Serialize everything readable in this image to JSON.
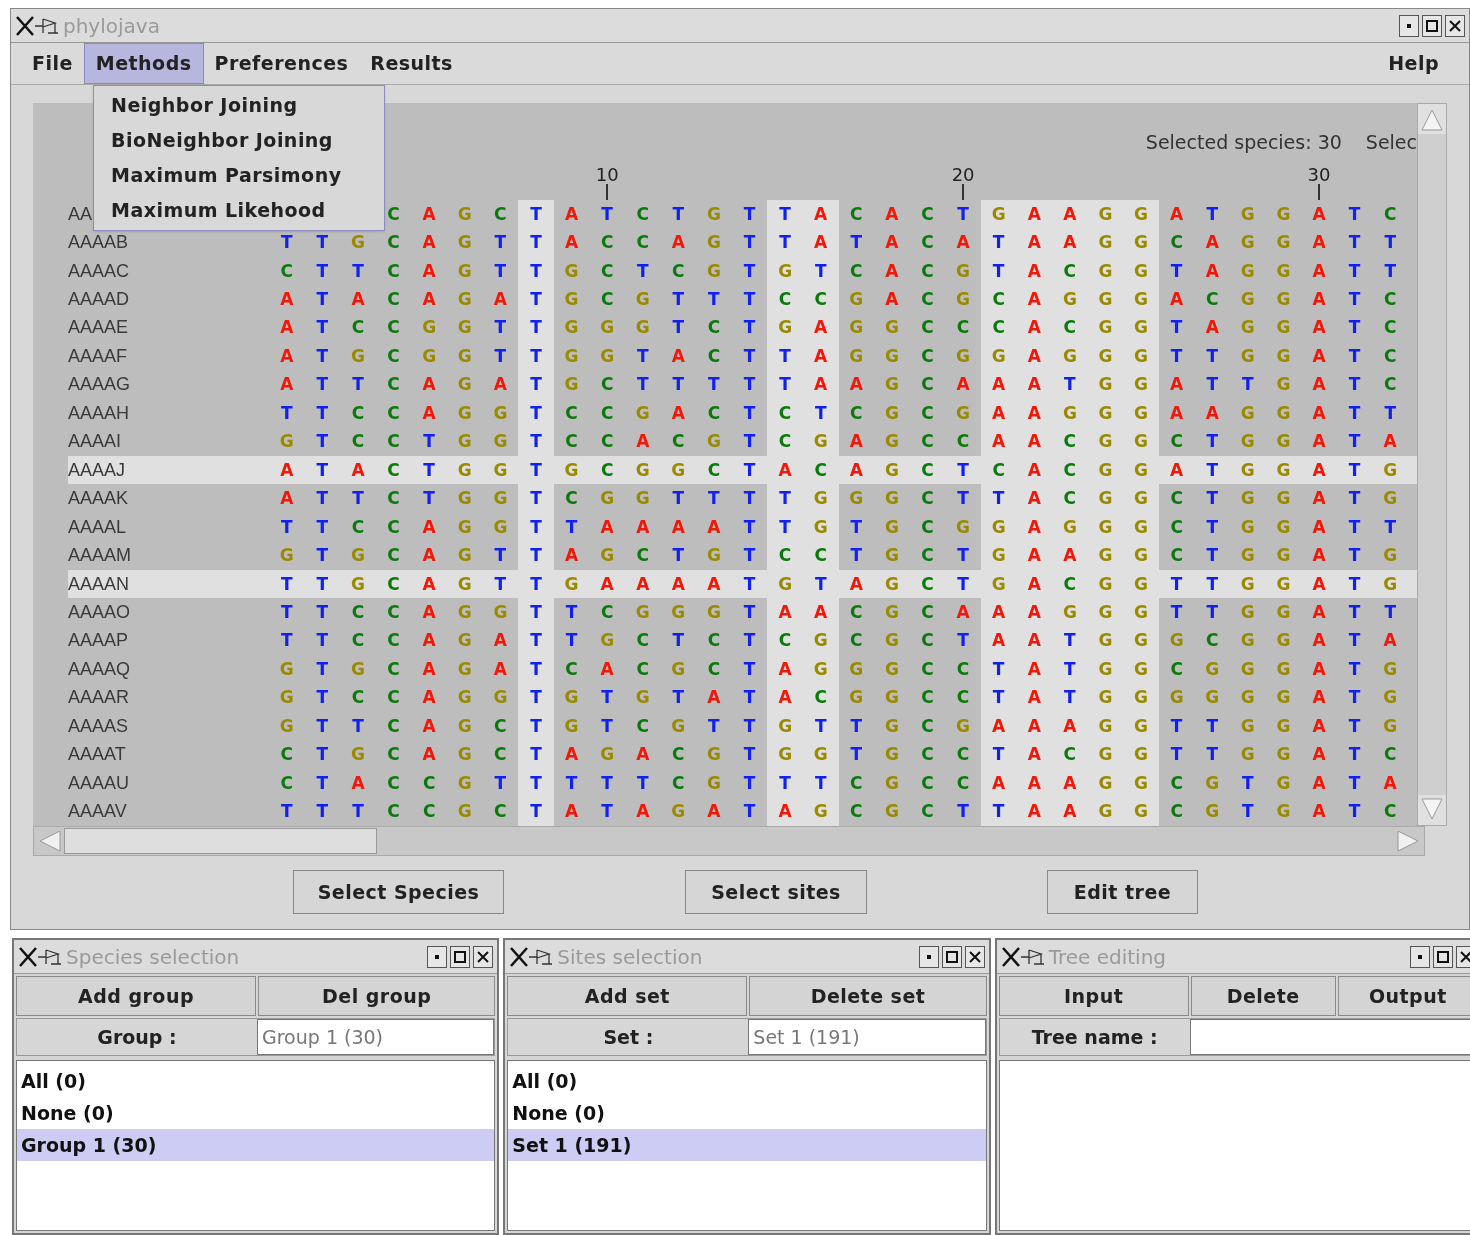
{
  "window": {
    "title": "phylojava"
  },
  "menu_bar": {
    "items": [
      {
        "label": "File",
        "selected": false
      },
      {
        "label": "Methods",
        "selected": true
      },
      {
        "label": "Preferences",
        "selected": false
      },
      {
        "label": "Results",
        "selected": false
      }
    ],
    "help": "Help"
  },
  "methods_menu": {
    "items": [
      "Neighbor Joining",
      "BioNeighbor Joining",
      "Maximum Parsimony",
      "Maximum Likehood"
    ]
  },
  "alignment": {
    "status": [
      "Selected species: 30",
      "Selec"
    ],
    "ruler": [
      "10",
      "20",
      "30"
    ],
    "site_selected": [
      false,
      false,
      false,
      false,
      false,
      false,
      false,
      true,
      false,
      false,
      false,
      false,
      false,
      false,
      true,
      true,
      false,
      false,
      false,
      false,
      true,
      true,
      true,
      true,
      true,
      false,
      false,
      false,
      false,
      false,
      false,
      false
    ],
    "rows": [
      {
        "name": "AA",
        "residues": "C A G C T A T C T G T T A C A C T G A A G G A T G G A T C",
        "selected": false
      },
      {
        "name": "AAAAB",
        "residues": "T T G C A G T T A C C A G T T A T A C A T A A G G C A G G A T T",
        "selected": false
      },
      {
        "name": "AAAAC",
        "residues": "C T T C A G T T G C T C G T G T C A C G T A C G G T A G G A T T",
        "selected": false
      },
      {
        "name": "AAAAD",
        "residues": "A T A C A G A T G C G T T T C C G A C G C A G G G A C G G A T C",
        "selected": false
      },
      {
        "name": "AAAAE",
        "residues": "A T C C G G T T G G G T C T G A G G C C C A C G G T A G G A T C",
        "selected": false
      },
      {
        "name": "AAAAF",
        "residues": "A T G C G G T T G G T A C T T A G G C G G A G G G T T G G A T C",
        "selected": false
      },
      {
        "name": "AAAAG",
        "residues": "A T T C A G A T G C T T T T T A A G C A A A T G G A T T G A T C",
        "selected": false
      },
      {
        "name": "AAAAH",
        "residues": "T T C C A G G T C C G A C T C T C G C G A A G G G A A G G A T T",
        "selected": false
      },
      {
        "name": "AAAAI",
        "residues": "G T C C T G G T C C A C G T C G A G C C A A C G G C T G G A T A",
        "selected": false
      },
      {
        "name": "AAAAJ",
        "residues": "A T A C T G G T G C G G C T A C A G C T C A C G G A T G G A T G",
        "selected": true
      },
      {
        "name": "AAAAK",
        "residues": "A T T C T G G T C G G T T T T G G G C T T A C G G C T G G A T G",
        "selected": false
      },
      {
        "name": "AAAAL",
        "residues": "T T C C A G G T T A A A A T T G T G C G G A G G G C T G G A T T",
        "selected": false
      },
      {
        "name": "AAAAM",
        "residues": "G T G C A G T T A G C T G T C C T G C T G A A G G C T G G A T G",
        "selected": false
      },
      {
        "name": "AAAAN",
        "residues": "T T G C A G T T G A A A A T G T A G C T G A C G G T T G G A T G",
        "selected": true
      },
      {
        "name": "AAAAO",
        "residues": "T T C C A G G T T C G G G T A A C G C A A A G G G T T G G A T T",
        "selected": false
      },
      {
        "name": "AAAAP",
        "residues": "T T C C A G A T T G C T C T C G C G C T A A T G G G C G G A T A",
        "selected": false
      },
      {
        "name": "AAAAQ",
        "residues": "G T G C A G A T C A C G C T A G G G C C T A T G G C G G G A T G",
        "selected": false
      },
      {
        "name": "AAAAR",
        "residues": "G T C C A G G T G T G T A T A C G G C C T A T G G G G G G A T G",
        "selected": false
      },
      {
        "name": "AAAAS",
        "residues": "G T T C A G C T G T C G T T G T T G C G A A A G G T T G G A T G",
        "selected": false
      },
      {
        "name": "AAAAT",
        "residues": "C T G C A G C T A G A C G T G G T G C C T A C G G T T G G A T C",
        "selected": false
      },
      {
        "name": "AAAAU",
        "residues": "C T A C C G T T T T T C G T T T C G C C A A A G G C G T G A T A",
        "selected": false
      },
      {
        "name": "AAAAV",
        "residues": "T T T C C G C T A T A G A T A G C G C T T A A G G C G T G A T C",
        "selected": false
      }
    ]
  },
  "buttons": [
    "Select Species",
    "Select sites",
    "Edit tree"
  ],
  "panels": [
    {
      "title": "Species selection",
      "buttons": [
        "Add group",
        "Del group"
      ],
      "field_label": "Group :",
      "field_value": "Group 1 (30)",
      "list": [
        {
          "label": "All (0)",
          "selected": false
        },
        {
          "label": "None (0)",
          "selected": false
        },
        {
          "label": "Group 1 (30)",
          "selected": true
        }
      ]
    },
    {
      "title": "Sites selection",
      "buttons": [
        "Add set",
        "Delete set"
      ],
      "field_label": "Set :",
      "field_value": "Set 1 (191)",
      "list": [
        {
          "label": "All (0)",
          "selected": false
        },
        {
          "label": "None (0)",
          "selected": false
        },
        {
          "label": "Set 1 (191)",
          "selected": true
        }
      ]
    },
    {
      "title": "Tree editing",
      "buttons": [
        "Input",
        "Delete",
        "Output"
      ],
      "field_label": "Tree name :"
    }
  ]
}
